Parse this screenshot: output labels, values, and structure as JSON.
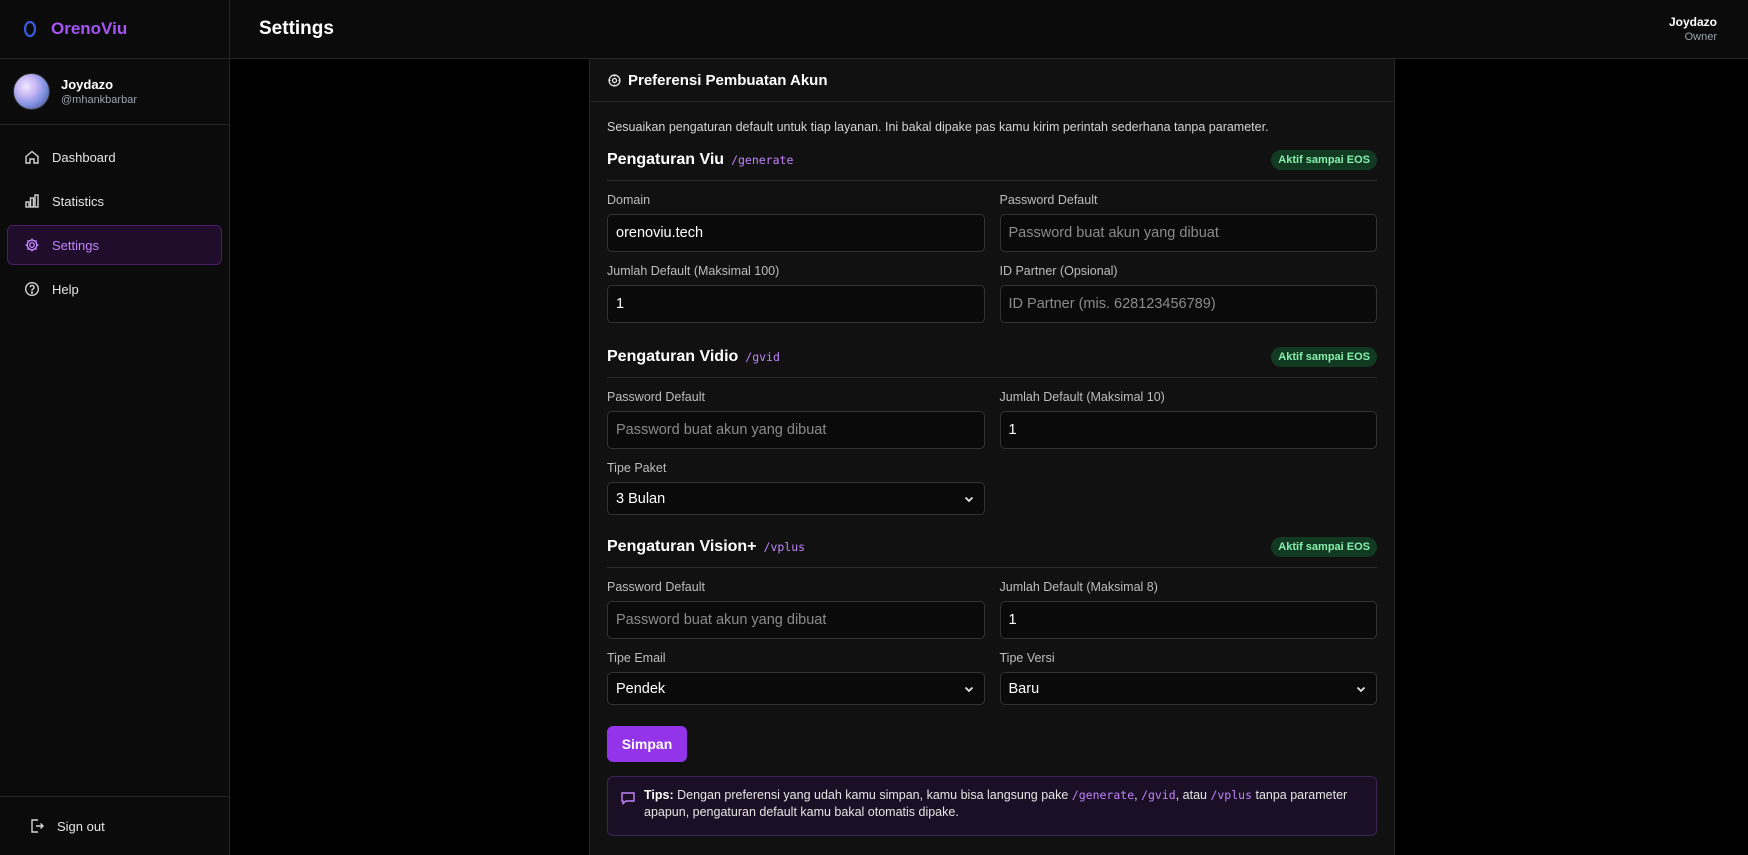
{
  "brand": {
    "name": "OrenoViu"
  },
  "profile": {
    "name": "Joydazo",
    "handle": "@mhankbarbar"
  },
  "nav": {
    "items": [
      {
        "label": "Dashboard"
      },
      {
        "label": "Statistics"
      },
      {
        "label": "Settings"
      },
      {
        "label": "Help"
      }
    ],
    "signout": "Sign out"
  },
  "topbar": {
    "title": "Settings",
    "user_name": "Joydazo",
    "user_role": "Owner"
  },
  "card": {
    "title": "Preferensi Pembuatan Akun",
    "description": "Sesuaikan pengaturan default untuk tiap layanan. Ini bakal dipake pas kamu kirim perintah sederhana tanpa parameter."
  },
  "viu": {
    "title": "Pengaturan Viu",
    "command": "/generate",
    "badge": "Aktif sampai EOS",
    "domain_label": "Domain",
    "domain_value": "orenoviu.tech",
    "password_label": "Password Default",
    "password_placeholder": "Password buat akun yang dibuat",
    "amount_label": "Jumlah Default (Maksimal 100)",
    "amount_value": "1",
    "partner_label": "ID Partner (Opsional)",
    "partner_placeholder": "ID Partner (mis. 628123456789)"
  },
  "vidio": {
    "title": "Pengaturan Vidio",
    "command": "/gvid",
    "badge": "Aktif sampai EOS",
    "password_label": "Password Default",
    "password_placeholder": "Password buat akun yang dibuat",
    "amount_label": "Jumlah Default (Maksimal 10)",
    "amount_value": "1",
    "package_label": "Tipe Paket",
    "package_value": "3 Bulan"
  },
  "vision": {
    "title": "Pengaturan Vision+",
    "command": "/vplus",
    "badge": "Aktif sampai EOS",
    "password_label": "Password Default",
    "password_placeholder": "Password buat akun yang dibuat",
    "amount_label": "Jumlah Default (Maksimal 8)",
    "amount_value": "1",
    "email_type_label": "Tipe Email",
    "email_type_value": "Pendek",
    "version_label": "Tipe Versi",
    "version_value": "Baru"
  },
  "save_label": "Simpan",
  "tips": {
    "lead": "Tips:",
    "text1": " Dengan preferensi yang udah kamu simpan, kamu bisa langsung pake ",
    "cmd1": "/generate",
    "sep1": ", ",
    "cmd2": "/gvid",
    "sep2": ", atau ",
    "cmd3": "/vplus",
    "text2": " tanpa parameter apapun, pengaturan default kamu bakal otomatis dipake."
  },
  "colors": {
    "accent": "#a855f7",
    "button": "#9333ea",
    "badge_bg": "#123a22",
    "badge_text": "#86efac"
  }
}
